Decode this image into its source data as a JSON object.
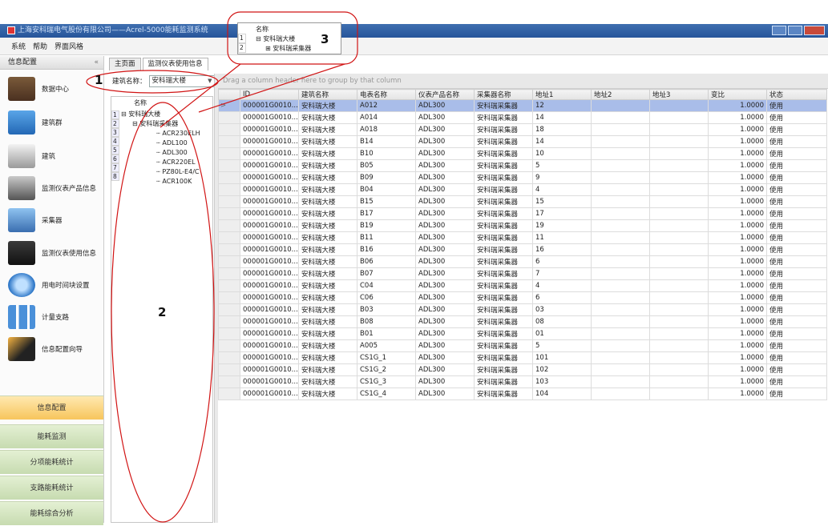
{
  "titlebar": {
    "title": "上海安科瑞电气股份有限公司——Acrel-5000能耗监测系统"
  },
  "menu": [
    "系统",
    "帮助",
    "界面风格"
  ],
  "left_panel": {
    "header": "信息配置",
    "collapse": "«",
    "items": [
      "数据中心",
      "建筑群",
      "建筑",
      "监测仪表产品信息",
      "采集器",
      "监测仪表使用信息",
      "用电时间块设置",
      "计量支路",
      "信息配置向导"
    ],
    "bottom_buttons": [
      "信息配置",
      "能耗监测",
      "分项能耗统计",
      "支路能耗统计",
      "能耗综合分析"
    ]
  },
  "tabs": [
    "主页面",
    "监测仪表使用信息"
  ],
  "building_filter": {
    "label": "建筑名称：",
    "value": "安科瑞大楼"
  },
  "tree": {
    "header": "名称",
    "row_numbers": [
      "1",
      "2",
      "3",
      "4",
      "5",
      "6",
      "7",
      "8"
    ],
    "root": "安科瑞大楼",
    "collector": "安科瑞采集器",
    "meters": [
      "ACR230ELH",
      "ADL100",
      "ADL300",
      "ACR220EL",
      "PZ80L-E4/C",
      "ACR100K"
    ],
    "selected_meter": "ADL300"
  },
  "popup": {
    "header": "名称",
    "row_numbers": [
      "1",
      "2"
    ],
    "root": "安科瑞大楼",
    "child": "安科瑞采集器"
  },
  "annotations": [
    "1",
    "2",
    "3"
  ],
  "grid": {
    "group_hint": "Drag a column header here to group by that column",
    "indicator": ">",
    "columns": [
      "ID",
      "建筑名称",
      "电表名称",
      "仪表产品名称",
      "采集器名称",
      "地址1",
      "地址2",
      "地址3",
      "变比",
      "状态"
    ],
    "rows": [
      [
        "000001G0010...",
        "安科瑞大楼",
        "A012",
        "ADL300",
        "安科瑞采集器",
        "12",
        "",
        "",
        "1.0000",
        "使用"
      ],
      [
        "000001G0010...",
        "安科瑞大楼",
        "A014",
        "ADL300",
        "安科瑞采集器",
        "14",
        "",
        "",
        "1.0000",
        "使用"
      ],
      [
        "000001G0010...",
        "安科瑞大楼",
        "A018",
        "ADL300",
        "安科瑞采集器",
        "18",
        "",
        "",
        "1.0000",
        "使用"
      ],
      [
        "000001G0010...",
        "安科瑞大楼",
        "B14",
        "ADL300",
        "安科瑞采集器",
        "14",
        "",
        "",
        "1.0000",
        "使用"
      ],
      [
        "000001G0010...",
        "安科瑞大楼",
        "B10",
        "ADL300",
        "安科瑞采集器",
        "10",
        "",
        "",
        "1.0000",
        "使用"
      ],
      [
        "000001G0010...",
        "安科瑞大楼",
        "B05",
        "ADL300",
        "安科瑞采集器",
        "5",
        "",
        "",
        "1.0000",
        "使用"
      ],
      [
        "000001G0010...",
        "安科瑞大楼",
        "B09",
        "ADL300",
        "安科瑞采集器",
        "9",
        "",
        "",
        "1.0000",
        "使用"
      ],
      [
        "000001G0010...",
        "安科瑞大楼",
        "B04",
        "ADL300",
        "安科瑞采集器",
        "4",
        "",
        "",
        "1.0000",
        "使用"
      ],
      [
        "000001G0010...",
        "安科瑞大楼",
        "B15",
        "ADL300",
        "安科瑞采集器",
        "15",
        "",
        "",
        "1.0000",
        "使用"
      ],
      [
        "000001G0010...",
        "安科瑞大楼",
        "B17",
        "ADL300",
        "安科瑞采集器",
        "17",
        "",
        "",
        "1.0000",
        "使用"
      ],
      [
        "000001G0010...",
        "安科瑞大楼",
        "B19",
        "ADL300",
        "安科瑞采集器",
        "19",
        "",
        "",
        "1.0000",
        "使用"
      ],
      [
        "000001G0010...",
        "安科瑞大楼",
        "B11",
        "ADL300",
        "安科瑞采集器",
        "11",
        "",
        "",
        "1.0000",
        "使用"
      ],
      [
        "000001G0010...",
        "安科瑞大楼",
        "B16",
        "ADL300",
        "安科瑞采集器",
        "16",
        "",
        "",
        "1.0000",
        "使用"
      ],
      [
        "000001G0010...",
        "安科瑞大楼",
        "B06",
        "ADL300",
        "安科瑞采集器",
        "6",
        "",
        "",
        "1.0000",
        "使用"
      ],
      [
        "000001G0010...",
        "安科瑞大楼",
        "B07",
        "ADL300",
        "安科瑞采集器",
        "7",
        "",
        "",
        "1.0000",
        "使用"
      ],
      [
        "000001G0010...",
        "安科瑞大楼",
        "C04",
        "ADL300",
        "安科瑞采集器",
        "4",
        "",
        "",
        "1.0000",
        "使用"
      ],
      [
        "000001G0010...",
        "安科瑞大楼",
        "C06",
        "ADL300",
        "安科瑞采集器",
        "6",
        "",
        "",
        "1.0000",
        "使用"
      ],
      [
        "000001G0010...",
        "安科瑞大楼",
        "B03",
        "ADL300",
        "安科瑞采集器",
        "03",
        "",
        "",
        "1.0000",
        "使用"
      ],
      [
        "000001G0010...",
        "安科瑞大楼",
        "B08",
        "ADL300",
        "安科瑞采集器",
        "08",
        "",
        "",
        "1.0000",
        "使用"
      ],
      [
        "000001G0010...",
        "安科瑞大楼",
        "B01",
        "ADL300",
        "安科瑞采集器",
        "01",
        "",
        "",
        "1.0000",
        "使用"
      ],
      [
        "000001G0010...",
        "安科瑞大楼",
        "A005",
        "ADL300",
        "安科瑞采集器",
        "5",
        "",
        "",
        "1.0000",
        "使用"
      ],
      [
        "000001G0010...",
        "安科瑞大楼",
        "CS1G_1",
        "ADL300",
        "安科瑞采集器",
        "101",
        "",
        "",
        "1.0000",
        "使用"
      ],
      [
        "000001G0010...",
        "安科瑞大楼",
        "CS1G_2",
        "ADL300",
        "安科瑞采集器",
        "102",
        "",
        "",
        "1.0000",
        "使用"
      ],
      [
        "000001G0010...",
        "安科瑞大楼",
        "CS1G_3",
        "ADL300",
        "安科瑞采集器",
        "103",
        "",
        "",
        "1.0000",
        "使用"
      ],
      [
        "000001G0010...",
        "安科瑞大楼",
        "CS1G_4",
        "ADL300",
        "安科瑞采集器",
        "104",
        "",
        "",
        "1.0000",
        "使用"
      ]
    ]
  },
  "colors": {
    "title_bar": "#2f5fa5",
    "selection": "#316ac5",
    "highlight_row": "#a9bde9",
    "active_nav": "#f7c55c",
    "nav_button": "#d4e5bf",
    "annotation": "#d11414"
  }
}
